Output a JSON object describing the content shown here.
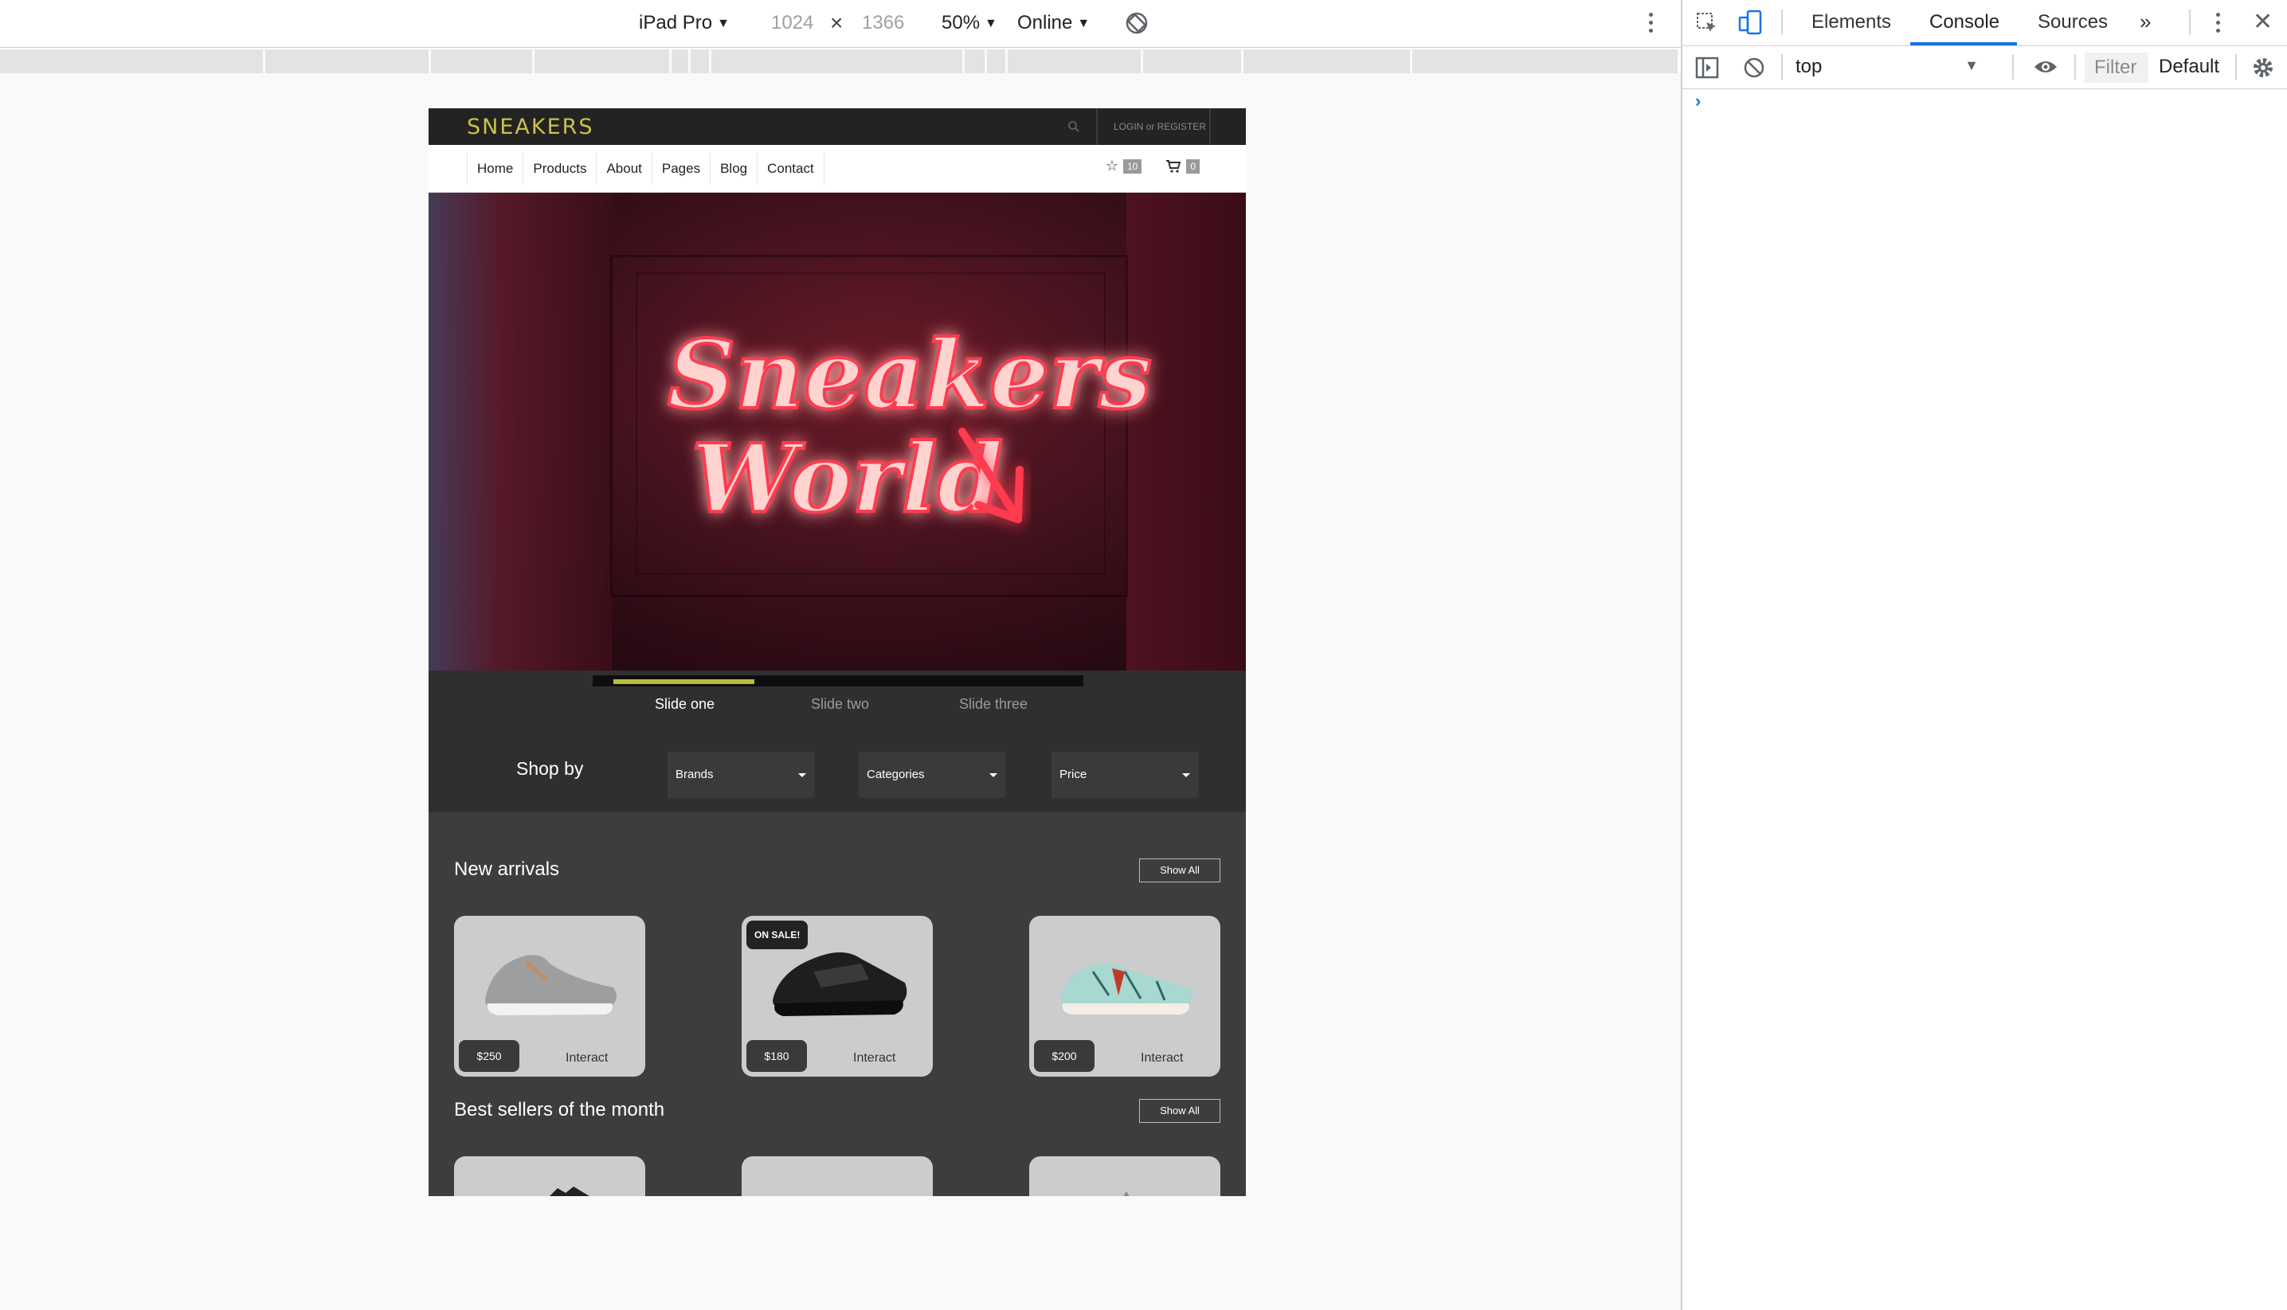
{
  "device_toolbar": {
    "device": "iPad Pro",
    "width": "1024",
    "height": "1366",
    "zoom": "50%",
    "network": "Online"
  },
  "site": {
    "logo": "SNEAKERS",
    "login": "LOGIN or REGISTER",
    "nav": [
      "Home",
      "Products",
      "About",
      "Pages",
      "Blog",
      "Contact"
    ],
    "wishlist_count": "10",
    "cart_count": "0",
    "hero_text_line1": "Sneakers",
    "hero_text_line2": "World",
    "slider": {
      "progress": 0.3,
      "slides": [
        "Slide one",
        "Slide two",
        "Slide three"
      ],
      "active_index": 0
    },
    "shop_by": {
      "title": "Shop by",
      "filters": [
        "Brands",
        "Categories",
        "Price"
      ]
    },
    "new_arrivals": {
      "title": "New arrivals",
      "show_all": "Show All",
      "products": [
        {
          "price": "$250",
          "action": "Interact",
          "badge": ""
        },
        {
          "price": "$180",
          "action": "Interact",
          "badge": "ON SALE!"
        },
        {
          "price": "$200",
          "action": "Interact",
          "badge": ""
        }
      ]
    },
    "best_sellers": {
      "title": "Best sellers of the month",
      "show_all": "Show All"
    }
  },
  "devtools": {
    "tabs": [
      "Elements",
      "Console",
      "Sources"
    ],
    "active_tab": "Console",
    "context": "top",
    "filter_placeholder": "Filter",
    "levels": "Default"
  },
  "colors": {
    "accent": "#b9bd3a",
    "logo": "#c9c24a",
    "devtools_blue": "#1a73e8"
  }
}
